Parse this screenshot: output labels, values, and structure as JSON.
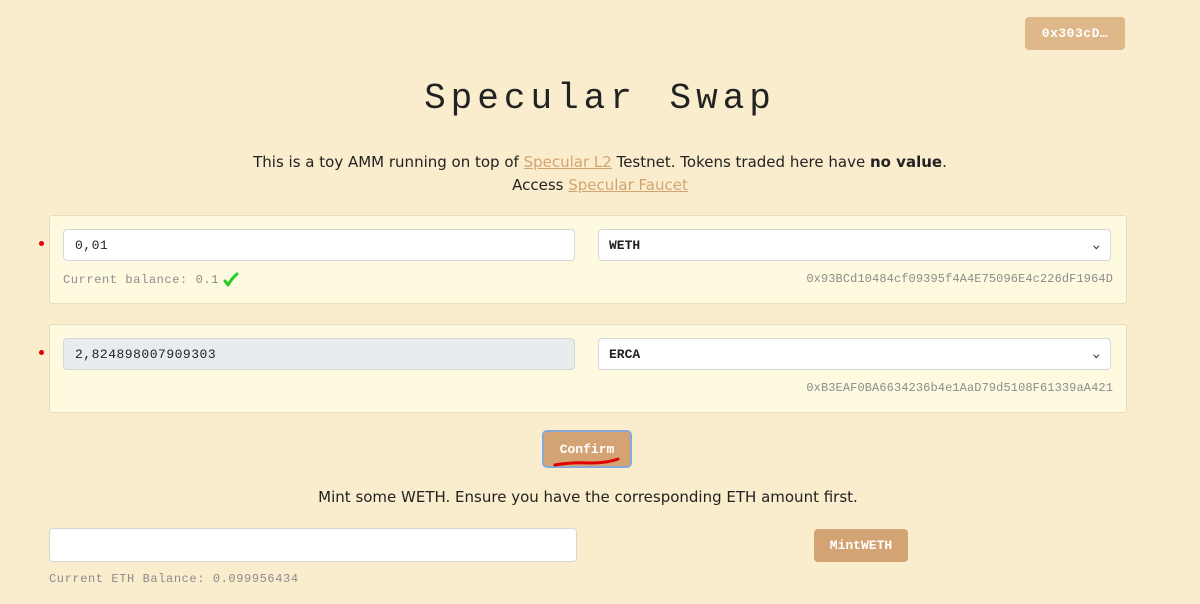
{
  "header": {
    "wallet_label": "0x303cD…",
    "title": "Specular Swap"
  },
  "intro": {
    "line1_prefix": "This is a toy AMM running on top of ",
    "link_l2": "Specular L2",
    "line1_middle": " Testnet. Tokens traded here have ",
    "line1_bold": "no value",
    "line1_suffix": ".",
    "line2_prefix": "Access ",
    "link_faucet": "Specular Faucet"
  },
  "swap": {
    "from": {
      "amount": "0,01",
      "token": "WETH",
      "balance_label": "Current balance: 0.1",
      "address": "0x93BCd10484cf09395f4A4E75096E4c226dF1964D"
    },
    "to": {
      "amount": "2,824898007909303",
      "token": "ERCA",
      "address": "0xB3EAF0BA6634236b4e1AaD79d5108F61339aA421"
    },
    "confirm_label": "Confirm"
  },
  "mint": {
    "note": "Mint some WETH. Ensure you have the corresponding ETH amount first.",
    "input_value": "",
    "button_label": "MintWETH",
    "eth_balance_label": "Current ETH Balance: 0.099956434"
  },
  "colors": {
    "background": "#faedcd",
    "panel": "#fefae0",
    "accent": "#d4a373",
    "wallet_button": "#dfb889",
    "marker": "#e00000",
    "check": "#22cc22"
  }
}
